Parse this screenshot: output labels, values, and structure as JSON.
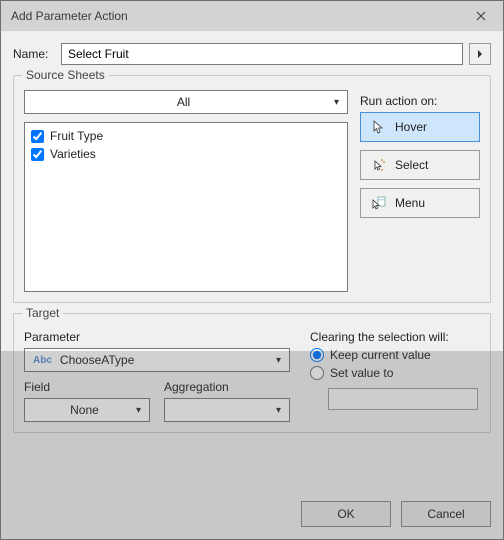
{
  "dialog": {
    "title": "Add Parameter Action"
  },
  "name": {
    "label": "Name:",
    "value": "Select Fruit"
  },
  "source_sheets": {
    "legend": "Source Sheets",
    "selector": "All",
    "sheets": [
      {
        "label": "Fruit Type",
        "checked": true
      },
      {
        "label": "Varieties",
        "checked": true
      }
    ]
  },
  "run_action": {
    "label": "Run action on:",
    "options": [
      {
        "label": "Hover",
        "selected": true,
        "icon": "hover"
      },
      {
        "label": "Select",
        "selected": false,
        "icon": "select"
      },
      {
        "label": "Menu",
        "selected": false,
        "icon": "menu"
      }
    ]
  },
  "target": {
    "legend": "Target",
    "parameter_label": "Parameter",
    "parameter_value": "ChooseAType",
    "field_label": "Field",
    "field_value": "None",
    "aggregation_label": "Aggregation",
    "aggregation_value": ""
  },
  "clearing": {
    "label": "Clearing the selection will:",
    "keep_label": "Keep current value",
    "set_label": "Set value to",
    "selected": "keep",
    "set_value": ""
  },
  "buttons": {
    "ok": "OK",
    "cancel": "Cancel"
  }
}
